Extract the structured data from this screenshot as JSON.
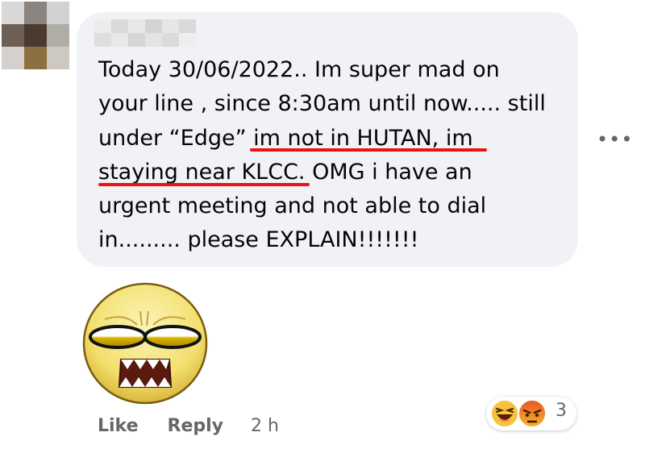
{
  "comment": {
    "lines": [
      "Today 30/06/2022.. Im super mad on",
      "your line , since 8:30am until now..... still",
      "under “Edge” im not in HUTAN, im",
      "staying near KLCC. OMG i have an",
      "urgent meeting and not able to dial",
      "in......... please EXPLAIN!!!!!!!"
    ]
  },
  "actions": {
    "like_label": "Like",
    "reply_label": "Reply",
    "timestamp": "2 h"
  },
  "reactions": {
    "icons": [
      "laugh-reaction-icon",
      "angry-reaction-icon"
    ],
    "count": "3"
  },
  "more_options_label": "•••",
  "colors": {
    "bubble_background": "#f0f2f5",
    "underline_annotation": "#ee1111",
    "secondary_text": "#65676b",
    "sticker_yellow": "#f3df6e"
  }
}
